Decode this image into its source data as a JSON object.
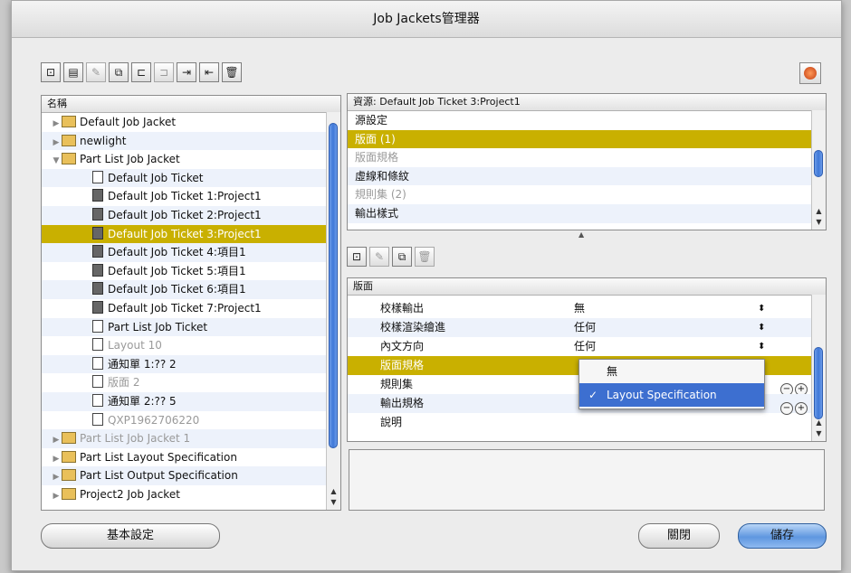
{
  "window": {
    "title": "Job Jackets管理器"
  },
  "colors": {
    "selection": "#c9b000",
    "popup_highlight": "#3d6fd0",
    "default_button": "#5f97e0"
  },
  "left_toolbar": {
    "icons": [
      "new-jacket-icon",
      "new-ticket-icon",
      "edit-pencil-icon",
      "duplicate-icon",
      "open-folder-icon",
      "link-icon",
      "import-icon",
      "export-icon",
      "trash-icon"
    ]
  },
  "tree": {
    "header": "名稱",
    "items": [
      {
        "label": "Default Job Jacket",
        "kind": "jacket",
        "level": 0,
        "dim": false,
        "selected": false
      },
      {
        "label": "newlight",
        "kind": "jacket",
        "level": 0,
        "dim": false,
        "selected": false
      },
      {
        "label": "Part List Job Jacket",
        "kind": "jacket-open",
        "level": 0,
        "dim": false,
        "selected": false
      },
      {
        "label": "Default Job Ticket",
        "kind": "ticket-blank",
        "level": 2,
        "dim": false,
        "selected": false
      },
      {
        "label": "Default Job Ticket 1:Project1",
        "kind": "ticket",
        "level": 2,
        "dim": false,
        "selected": false
      },
      {
        "label": "Default Job Ticket 2:Project1",
        "kind": "ticket",
        "level": 2,
        "dim": false,
        "selected": false
      },
      {
        "label": "Default Job Ticket 3:Project1",
        "kind": "ticket",
        "level": 2,
        "dim": false,
        "selected": true
      },
      {
        "label": "Default Job Ticket 4:項目1",
        "kind": "ticket",
        "level": 2,
        "dim": false,
        "selected": false
      },
      {
        "label": "Default Job Ticket 5:項目1",
        "kind": "ticket",
        "level": 2,
        "dim": false,
        "selected": false
      },
      {
        "label": "Default Job Ticket 6:項目1",
        "kind": "ticket",
        "level": 2,
        "dim": false,
        "selected": false
      },
      {
        "label": "Default Job Ticket 7:Project1",
        "kind": "ticket",
        "level": 2,
        "dim": false,
        "selected": false
      },
      {
        "label": "Part List Job Ticket",
        "kind": "ticket-stack",
        "level": 2,
        "dim": false,
        "selected": false
      },
      {
        "label": "Layout 10",
        "kind": "ticket-stack",
        "level": 2,
        "dim": true,
        "selected": false
      },
      {
        "label": "通知單 1:?? 2",
        "kind": "ticket-stack",
        "level": 2,
        "dim": false,
        "selected": false
      },
      {
        "label": "版面 2",
        "kind": "ticket-stack",
        "level": 2,
        "dim": true,
        "selected": false
      },
      {
        "label": "通知單 2:?? 5",
        "kind": "ticket-stack",
        "level": 2,
        "dim": false,
        "selected": false
      },
      {
        "label": "QXP1962706220",
        "kind": "ticket-stack",
        "level": 2,
        "dim": true,
        "selected": false
      },
      {
        "label": "Part List Job Jacket 1",
        "kind": "jacket",
        "level": 0,
        "dim": true,
        "selected": false
      },
      {
        "label": "Part List Layout Specification",
        "kind": "jacket",
        "level": 0,
        "dim": false,
        "selected": false
      },
      {
        "label": "Part List Output Specification",
        "kind": "jacket",
        "level": 0,
        "dim": false,
        "selected": false
      },
      {
        "label": "Project2 Job Jacket",
        "kind": "jacket",
        "level": 0,
        "dim": false,
        "selected": false
      }
    ]
  },
  "resources": {
    "header": "資源: Default Job Ticket 3:Project1",
    "items": [
      {
        "label": "源設定",
        "dim": false,
        "selected": false
      },
      {
        "label": "版面 (1)",
        "dim": false,
        "selected": true
      },
      {
        "label": "版面規格",
        "dim": true,
        "selected": false
      },
      {
        "label": "虛線和條紋",
        "dim": false,
        "selected": false
      },
      {
        "label": "規則集 (2)",
        "dim": true,
        "selected": false
      },
      {
        "label": "輸出樣式",
        "dim": false,
        "selected": false
      }
    ]
  },
  "right_toolbar": {
    "icons": [
      "new-layout-icon",
      "edit-pencil-icon",
      "duplicate-icon",
      "trash-icon"
    ]
  },
  "layout_table": {
    "header": "版面",
    "rows": [
      {
        "name": "校樣輸出",
        "value": "無",
        "selected": false,
        "has_plus_minus": false
      },
      {
        "name": "校樣渲染繪進",
        "value": "任何",
        "selected": false,
        "has_plus_minus": false
      },
      {
        "name": "內文方向",
        "value": "任何",
        "selected": false,
        "has_plus_minus": false
      },
      {
        "name": "版面規格",
        "value": "",
        "selected": true,
        "has_plus_minus": false
      },
      {
        "name": "規則集",
        "value": "",
        "selected": false,
        "has_plus_minus": true
      },
      {
        "name": "輸出規格",
        "value": "",
        "selected": false,
        "has_plus_minus": true
      },
      {
        "name": "說明",
        "value": "",
        "selected": false,
        "has_plus_minus": false
      }
    ]
  },
  "popup": {
    "options": [
      {
        "label": "無",
        "checked": false,
        "highlighted": false
      },
      {
        "label": "Layout Specification",
        "checked": true,
        "highlighted": true
      }
    ],
    "check_mark": "✓"
  },
  "buttons": {
    "basic_settings": "基本設定",
    "close": "關閉",
    "save": "儲存"
  }
}
